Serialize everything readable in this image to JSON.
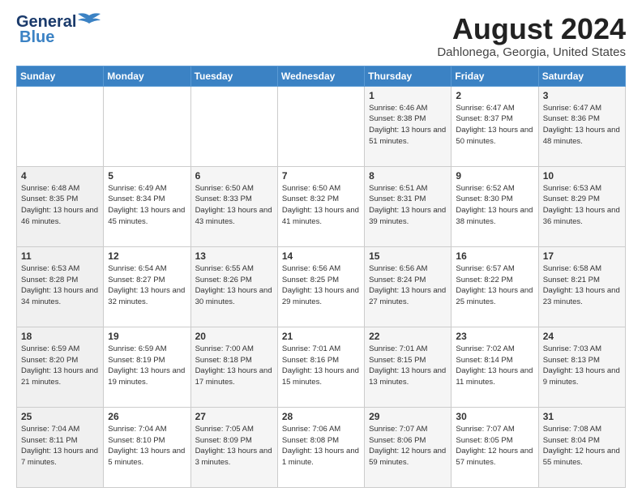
{
  "logo": {
    "line1": "General",
    "line2": "Blue"
  },
  "title": "August 2024",
  "location": "Dahlonega, Georgia, United States",
  "days_of_week": [
    "Sunday",
    "Monday",
    "Tuesday",
    "Wednesday",
    "Thursday",
    "Friday",
    "Saturday"
  ],
  "weeks": [
    [
      {
        "day": "",
        "sunrise": "",
        "sunset": "",
        "daylight": ""
      },
      {
        "day": "",
        "sunrise": "",
        "sunset": "",
        "daylight": ""
      },
      {
        "day": "",
        "sunrise": "",
        "sunset": "",
        "daylight": ""
      },
      {
        "day": "",
        "sunrise": "",
        "sunset": "",
        "daylight": ""
      },
      {
        "day": "1",
        "sunrise": "Sunrise: 6:46 AM",
        "sunset": "Sunset: 8:38 PM",
        "daylight": "Daylight: 13 hours and 51 minutes."
      },
      {
        "day": "2",
        "sunrise": "Sunrise: 6:47 AM",
        "sunset": "Sunset: 8:37 PM",
        "daylight": "Daylight: 13 hours and 50 minutes."
      },
      {
        "day": "3",
        "sunrise": "Sunrise: 6:47 AM",
        "sunset": "Sunset: 8:36 PM",
        "daylight": "Daylight: 13 hours and 48 minutes."
      }
    ],
    [
      {
        "day": "4",
        "sunrise": "Sunrise: 6:48 AM",
        "sunset": "Sunset: 8:35 PM",
        "daylight": "Daylight: 13 hours and 46 minutes."
      },
      {
        "day": "5",
        "sunrise": "Sunrise: 6:49 AM",
        "sunset": "Sunset: 8:34 PM",
        "daylight": "Daylight: 13 hours and 45 minutes."
      },
      {
        "day": "6",
        "sunrise": "Sunrise: 6:50 AM",
        "sunset": "Sunset: 8:33 PM",
        "daylight": "Daylight: 13 hours and 43 minutes."
      },
      {
        "day": "7",
        "sunrise": "Sunrise: 6:50 AM",
        "sunset": "Sunset: 8:32 PM",
        "daylight": "Daylight: 13 hours and 41 minutes."
      },
      {
        "day": "8",
        "sunrise": "Sunrise: 6:51 AM",
        "sunset": "Sunset: 8:31 PM",
        "daylight": "Daylight: 13 hours and 39 minutes."
      },
      {
        "day": "9",
        "sunrise": "Sunrise: 6:52 AM",
        "sunset": "Sunset: 8:30 PM",
        "daylight": "Daylight: 13 hours and 38 minutes."
      },
      {
        "day": "10",
        "sunrise": "Sunrise: 6:53 AM",
        "sunset": "Sunset: 8:29 PM",
        "daylight": "Daylight: 13 hours and 36 minutes."
      }
    ],
    [
      {
        "day": "11",
        "sunrise": "Sunrise: 6:53 AM",
        "sunset": "Sunset: 8:28 PM",
        "daylight": "Daylight: 13 hours and 34 minutes."
      },
      {
        "day": "12",
        "sunrise": "Sunrise: 6:54 AM",
        "sunset": "Sunset: 8:27 PM",
        "daylight": "Daylight: 13 hours and 32 minutes."
      },
      {
        "day": "13",
        "sunrise": "Sunrise: 6:55 AM",
        "sunset": "Sunset: 8:26 PM",
        "daylight": "Daylight: 13 hours and 30 minutes."
      },
      {
        "day": "14",
        "sunrise": "Sunrise: 6:56 AM",
        "sunset": "Sunset: 8:25 PM",
        "daylight": "Daylight: 13 hours and 29 minutes."
      },
      {
        "day": "15",
        "sunrise": "Sunrise: 6:56 AM",
        "sunset": "Sunset: 8:24 PM",
        "daylight": "Daylight: 13 hours and 27 minutes."
      },
      {
        "day": "16",
        "sunrise": "Sunrise: 6:57 AM",
        "sunset": "Sunset: 8:22 PM",
        "daylight": "Daylight: 13 hours and 25 minutes."
      },
      {
        "day": "17",
        "sunrise": "Sunrise: 6:58 AM",
        "sunset": "Sunset: 8:21 PM",
        "daylight": "Daylight: 13 hours and 23 minutes."
      }
    ],
    [
      {
        "day": "18",
        "sunrise": "Sunrise: 6:59 AM",
        "sunset": "Sunset: 8:20 PM",
        "daylight": "Daylight: 13 hours and 21 minutes."
      },
      {
        "day": "19",
        "sunrise": "Sunrise: 6:59 AM",
        "sunset": "Sunset: 8:19 PM",
        "daylight": "Daylight: 13 hours and 19 minutes."
      },
      {
        "day": "20",
        "sunrise": "Sunrise: 7:00 AM",
        "sunset": "Sunset: 8:18 PM",
        "daylight": "Daylight: 13 hours and 17 minutes."
      },
      {
        "day": "21",
        "sunrise": "Sunrise: 7:01 AM",
        "sunset": "Sunset: 8:16 PM",
        "daylight": "Daylight: 13 hours and 15 minutes."
      },
      {
        "day": "22",
        "sunrise": "Sunrise: 7:01 AM",
        "sunset": "Sunset: 8:15 PM",
        "daylight": "Daylight: 13 hours and 13 minutes."
      },
      {
        "day": "23",
        "sunrise": "Sunrise: 7:02 AM",
        "sunset": "Sunset: 8:14 PM",
        "daylight": "Daylight: 13 hours and 11 minutes."
      },
      {
        "day": "24",
        "sunrise": "Sunrise: 7:03 AM",
        "sunset": "Sunset: 8:13 PM",
        "daylight": "Daylight: 13 hours and 9 minutes."
      }
    ],
    [
      {
        "day": "25",
        "sunrise": "Sunrise: 7:04 AM",
        "sunset": "Sunset: 8:11 PM",
        "daylight": "Daylight: 13 hours and 7 minutes."
      },
      {
        "day": "26",
        "sunrise": "Sunrise: 7:04 AM",
        "sunset": "Sunset: 8:10 PM",
        "daylight": "Daylight: 13 hours and 5 minutes."
      },
      {
        "day": "27",
        "sunrise": "Sunrise: 7:05 AM",
        "sunset": "Sunset: 8:09 PM",
        "daylight": "Daylight: 13 hours and 3 minutes."
      },
      {
        "day": "28",
        "sunrise": "Sunrise: 7:06 AM",
        "sunset": "Sunset: 8:08 PM",
        "daylight": "Daylight: 13 hours and 1 minute."
      },
      {
        "day": "29",
        "sunrise": "Sunrise: 7:07 AM",
        "sunset": "Sunset: 8:06 PM",
        "daylight": "Daylight: 12 hours and 59 minutes."
      },
      {
        "day": "30",
        "sunrise": "Sunrise: 7:07 AM",
        "sunset": "Sunset: 8:05 PM",
        "daylight": "Daylight: 12 hours and 57 minutes."
      },
      {
        "day": "31",
        "sunrise": "Sunrise: 7:08 AM",
        "sunset": "Sunset: 8:04 PM",
        "daylight": "Daylight: 12 hours and 55 minutes."
      }
    ]
  ]
}
